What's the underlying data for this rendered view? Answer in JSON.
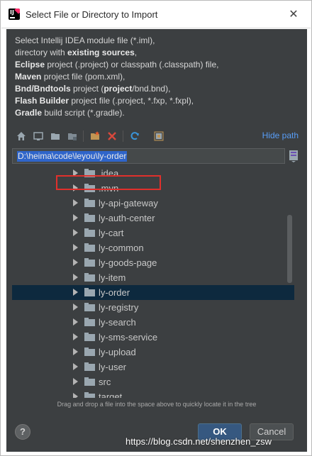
{
  "window": {
    "title": "Select File or Directory to Import",
    "close_glyph": "✕",
    "app_icon": "intellij-icon"
  },
  "description": {
    "line1": "Select Intellij IDEA module file (*.iml),",
    "line2_pre": "directory with ",
    "line2_bold": "existing sources",
    "line2_post": ",",
    "line3_bold": "Eclipse",
    "line3_post": " project (.project) or classpath (.classpath) file,",
    "line4_bold": "Maven",
    "line4_post": " project file (pom.xml),",
    "line5_bold": "Bnd/Bndtools",
    "line5_mid": " project (",
    "line5_bold2": "project",
    "line5_post": "/bnd.bnd),",
    "line6_bold": "Flash Builder",
    "line6_post": " project file (.project, *.fxp, *.fxpl),",
    "line7_bold": "Gradle",
    "line7_post": " build script (*.gradle)."
  },
  "toolbar": {
    "icons": [
      "home-icon",
      "desktop-icon",
      "project-folder-icon",
      "module-folder-icon",
      "new-folder-icon",
      "delete-icon",
      "refresh-icon",
      "show-hidden-icon"
    ],
    "hide_path_label": "Hide path"
  },
  "path": {
    "value": "D:\\heima\\code\\leyou\\ly-order"
  },
  "tree": {
    "items": [
      {
        "label": ".idea",
        "selected": false
      },
      {
        "label": ".mvn",
        "selected": false
      },
      {
        "label": "ly-api-gateway",
        "selected": false
      },
      {
        "label": "ly-auth-center",
        "selected": false
      },
      {
        "label": "ly-cart",
        "selected": false
      },
      {
        "label": "ly-common",
        "selected": false
      },
      {
        "label": "ly-goods-page",
        "selected": false
      },
      {
        "label": "ly-item",
        "selected": false
      },
      {
        "label": "ly-order",
        "selected": true
      },
      {
        "label": "ly-registry",
        "selected": false
      },
      {
        "label": "ly-search",
        "selected": false
      },
      {
        "label": "ly-sms-service",
        "selected": false
      },
      {
        "label": "ly-upload",
        "selected": false
      },
      {
        "label": "ly-user",
        "selected": false
      },
      {
        "label": "src",
        "selected": false
      },
      {
        "label": "target",
        "selected": false
      }
    ]
  },
  "hint": "Drag and drop a file into the space above to quickly locate it in the tree",
  "buttons": {
    "help": "?",
    "ok": "OK",
    "cancel": "Cancel"
  },
  "watermark": "https://blog.csdn.net/shenzhen_zsw",
  "colors": {
    "dialog_bg": "#3c3f41",
    "selection_bg": "#0d293e",
    "highlight_border": "#e0302c",
    "link": "#589df6",
    "ok_button": "#365880"
  }
}
